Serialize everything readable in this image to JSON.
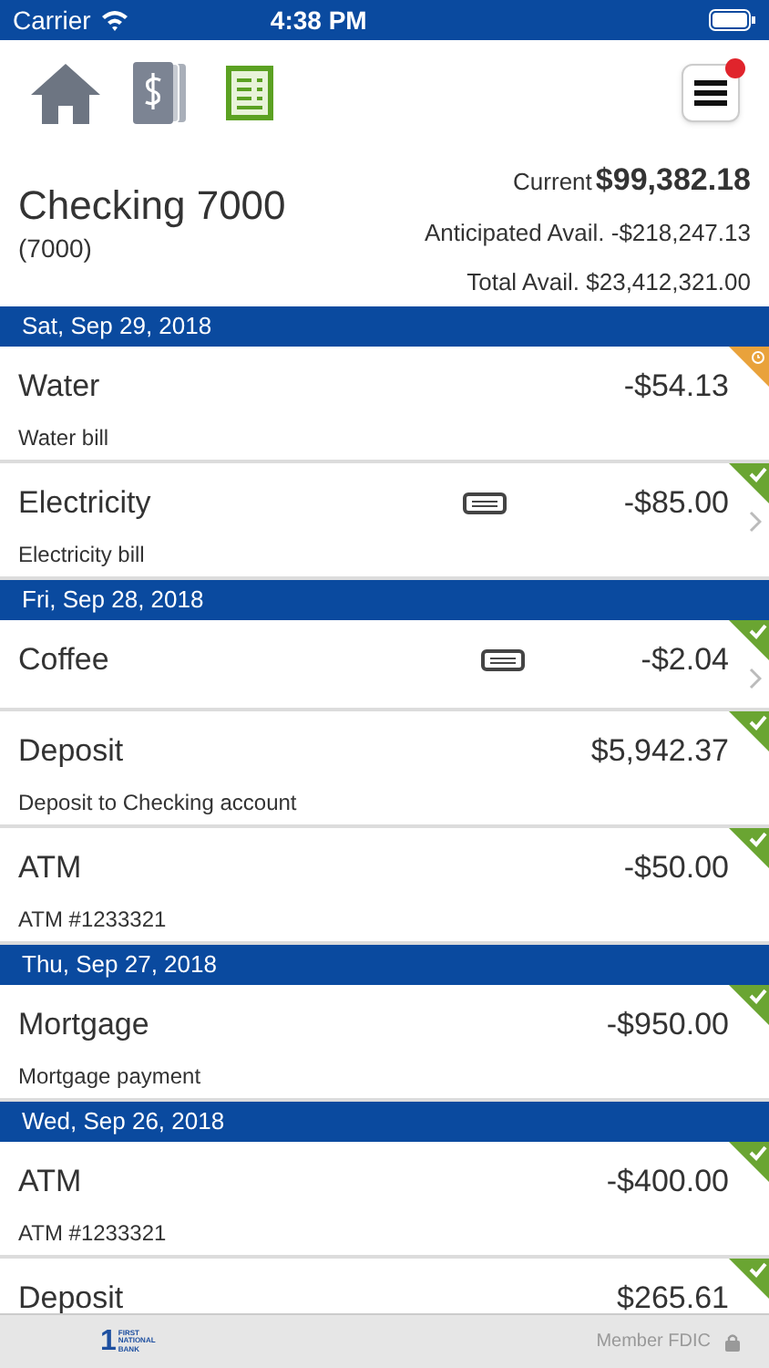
{
  "status_bar": {
    "carrier": "Carrier",
    "time": "4:38 PM"
  },
  "toolbar": {
    "menu_badge": true
  },
  "account": {
    "name": "Checking 7000",
    "number": "(7000)",
    "current_label": "Current",
    "current": "$99,382.18",
    "anticipated": "Anticipated Avail. -$218,247.13",
    "total": "Total Avail. $23,412,321.00"
  },
  "days": [
    {
      "date": "Sat, Sep 29, 2018",
      "transactions": [
        {
          "title": "Water",
          "amount": "-$54.13",
          "memo": "Water bill",
          "cleared": false,
          "note": false,
          "chevron": false
        },
        {
          "title": "Electricity",
          "amount": "-$85.00",
          "memo": "Electricity bill",
          "cleared": true,
          "note": true,
          "chevron": true
        }
      ]
    },
    {
      "date": "Fri, Sep 28, 2018",
      "transactions": [
        {
          "title": "Coffee",
          "amount": "-$2.04",
          "cleared": true,
          "note": true,
          "chevron": true
        },
        {
          "title": "Deposit",
          "amount": "$5,942.37",
          "memo": "Deposit to Checking account",
          "cleared": true,
          "note": false,
          "chevron": false
        },
        {
          "title": "ATM",
          "amount": "-$50.00",
          "memo": "ATM #1233321",
          "cleared": true,
          "note": false,
          "chevron": false
        }
      ]
    },
    {
      "date": "Thu, Sep 27, 2018",
      "transactions": [
        {
          "title": "Mortgage",
          "amount": "-$950.00",
          "memo": "Mortgage payment",
          "cleared": true,
          "note": false,
          "chevron": false
        }
      ]
    },
    {
      "date": "Wed, Sep 26, 2018",
      "transactions": [
        {
          "title": "ATM",
          "amount": "-$400.00",
          "memo": "ATM #1233321",
          "cleared": true,
          "note": false,
          "chevron": false
        },
        {
          "title": "Deposit",
          "amount": "$265.61",
          "cleared": true,
          "note": false,
          "chevron": false
        }
      ]
    }
  ],
  "footer": {
    "logo_mark": "1",
    "logo": [
      "FIRST",
      "NATIONAL",
      "BANK"
    ],
    "text": "Member FDIC"
  }
}
